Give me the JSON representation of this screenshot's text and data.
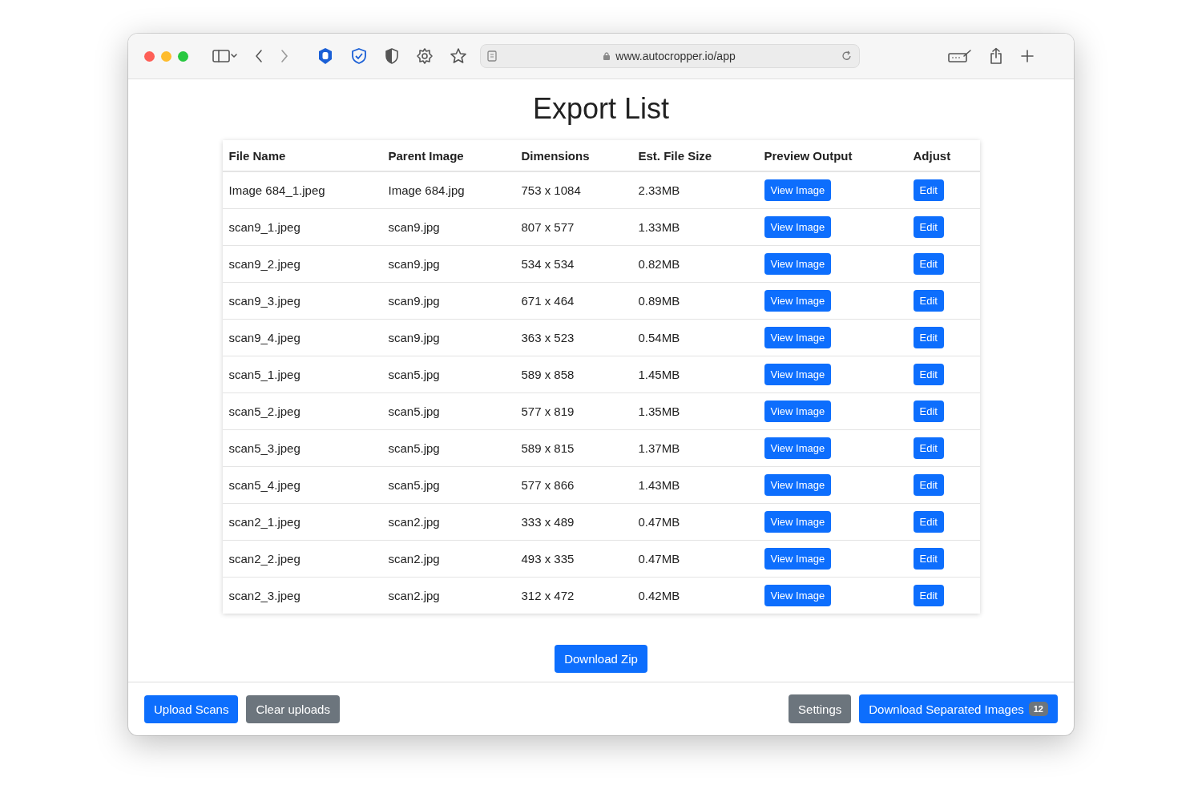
{
  "browser": {
    "url": "www.autocropper.io/app"
  },
  "page": {
    "title": "Export List"
  },
  "table": {
    "columns": [
      "File Name",
      "Parent Image",
      "Dimensions",
      "Est. File Size",
      "Preview Output",
      "Adjust"
    ],
    "rows": [
      {
        "file": "Image 684_1.jpeg",
        "parent": "Image 684.jpg",
        "dimensions": "753 x 1084",
        "size": "2.33MB",
        "preview": "View Image",
        "adjust": "Edit"
      },
      {
        "file": "scan9_1.jpeg",
        "parent": "scan9.jpg",
        "dimensions": "807 x 577",
        "size": "1.33MB",
        "preview": "View Image",
        "adjust": "Edit"
      },
      {
        "file": "scan9_2.jpeg",
        "parent": "scan9.jpg",
        "dimensions": "534 x 534",
        "size": "0.82MB",
        "preview": "View Image",
        "adjust": "Edit"
      },
      {
        "file": "scan9_3.jpeg",
        "parent": "scan9.jpg",
        "dimensions": "671 x 464",
        "size": "0.89MB",
        "preview": "View Image",
        "adjust": "Edit"
      },
      {
        "file": "scan9_4.jpeg",
        "parent": "scan9.jpg",
        "dimensions": "363 x 523",
        "size": "0.54MB",
        "preview": "View Image",
        "adjust": "Edit"
      },
      {
        "file": "scan5_1.jpeg",
        "parent": "scan5.jpg",
        "dimensions": "589 x 858",
        "size": "1.45MB",
        "preview": "View Image",
        "adjust": "Edit"
      },
      {
        "file": "scan5_2.jpeg",
        "parent": "scan5.jpg",
        "dimensions": "577 x 819",
        "size": "1.35MB",
        "preview": "View Image",
        "adjust": "Edit"
      },
      {
        "file": "scan5_3.jpeg",
        "parent": "scan5.jpg",
        "dimensions": "589 x 815",
        "size": "1.37MB",
        "preview": "View Image",
        "adjust": "Edit"
      },
      {
        "file": "scan5_4.jpeg",
        "parent": "scan5.jpg",
        "dimensions": "577 x 866",
        "size": "1.43MB",
        "preview": "View Image",
        "adjust": "Edit"
      },
      {
        "file": "scan2_1.jpeg",
        "parent": "scan2.jpg",
        "dimensions": "333 x 489",
        "size": "0.47MB",
        "preview": "View Image",
        "adjust": "Edit"
      },
      {
        "file": "scan2_2.jpeg",
        "parent": "scan2.jpg",
        "dimensions": "493 x 335",
        "size": "0.47MB",
        "preview": "View Image",
        "adjust": "Edit"
      },
      {
        "file": "scan2_3.jpeg",
        "parent": "scan2.jpg",
        "dimensions": "312 x 472",
        "size": "0.42MB",
        "preview": "View Image",
        "adjust": "Edit"
      }
    ]
  },
  "download_button": "Download Zip",
  "footer": {
    "left": [
      {
        "label": "Upload Scans",
        "kind": "primary"
      },
      {
        "label": "Clear uploads",
        "kind": "secondary"
      }
    ],
    "right": [
      {
        "label": "Settings",
        "kind": "secondary"
      },
      {
        "label": "Download Separated Images",
        "kind": "primary",
        "badge": "12"
      }
    ]
  }
}
